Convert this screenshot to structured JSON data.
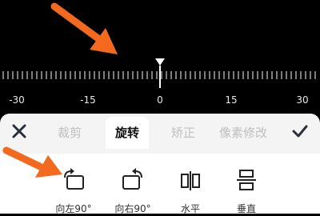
{
  "ruler": {
    "labels": [
      "-30",
      "-15",
      "0",
      "15",
      "30"
    ],
    "value": "0"
  },
  "toolbar": {
    "close_icon": "close-icon",
    "confirm_icon": "checkmark-icon",
    "tabs": [
      {
        "label": "裁剪",
        "active": false
      },
      {
        "label": "旋转",
        "active": true
      },
      {
        "label": "矫正",
        "active": false
      },
      {
        "label": "像素修改",
        "active": false
      }
    ]
  },
  "tools": [
    {
      "label": "向左90°",
      "icon": "rotate-left-icon"
    },
    {
      "label": "向右90°",
      "icon": "rotate-right-icon"
    },
    {
      "label": "水平",
      "icon": "flip-horizontal-icon"
    },
    {
      "label": "垂直",
      "icon": "flip-vertical-icon"
    }
  ],
  "colors": {
    "annotation_arrow": "#f36a1e",
    "panel_bg": "#f4f4f4",
    "active_tab": "#111111",
    "inactive_tab": "#bfbfbf"
  }
}
